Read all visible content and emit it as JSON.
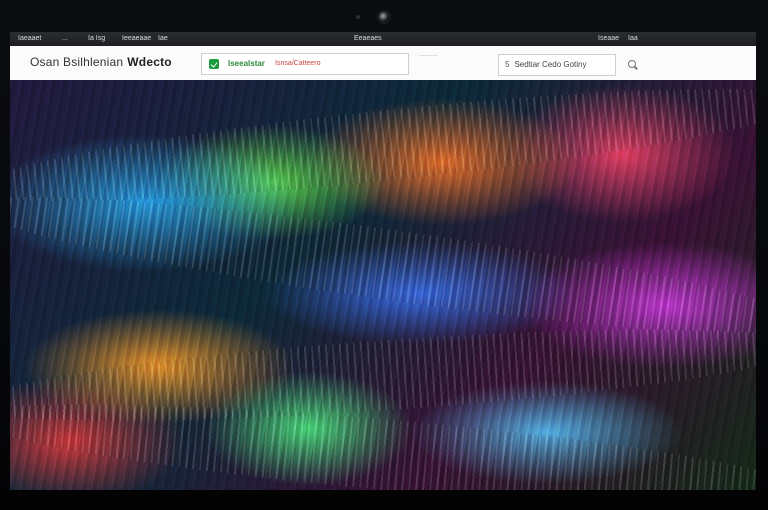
{
  "menubar": {
    "items": [
      "Iaeaaet",
      "...",
      "Ia  Isg",
      "Ieeaeaae",
      "Iae",
      "Eeaeaes",
      "Iseaae",
      "Iaa"
    ]
  },
  "toolbar": {
    "brand_prefix": "Osan Bsilhlenian",
    "brand_bold": "Wdecto",
    "search": {
      "value": "Iseealstar",
      "placeholder": "Isnsa/Catteero"
    },
    "divider_text": "...........",
    "selector": {
      "number": "5",
      "label": "Sedtiar Cedo Gotiny"
    }
  },
  "icons": {
    "camera": "camera-icon",
    "search_status": "check-icon",
    "toolbar_action": "search-icon"
  },
  "colors": {
    "accent_green": "#1c9a3e",
    "placeholder_red": "#cc4444",
    "menubar_bg": "#1d1f22"
  }
}
